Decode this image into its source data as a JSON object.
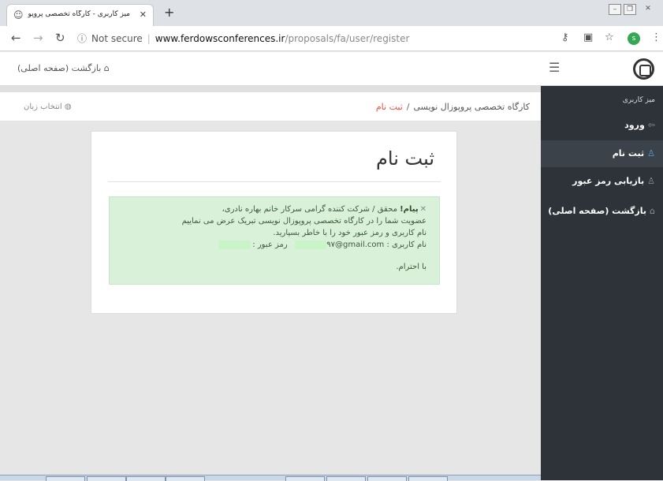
{
  "browser": {
    "tab_title": "میز کاربری - کارگاه تخصصی پروپوزال نو",
    "address": {
      "security_label": "Not secure",
      "host": "www.ferdowsconferences.ir",
      "path": "/proposals/fa/user/register"
    },
    "profile_letter": "s"
  },
  "header": {
    "back_label": "بازگشت (صفحه اصلی)"
  },
  "breadcrumb": {
    "parent": "کارگاه تخصصی پروپوزال نویسی",
    "separator": "/",
    "current": "ثبت نام"
  },
  "language_label": "انتخاب زبان",
  "sidebar": {
    "title": "میز کاربری",
    "items": [
      {
        "label": "ورود",
        "icon": "sign-in-icon"
      },
      {
        "label": "ثبت نام",
        "icon": "user-icon"
      },
      {
        "label": "بازیابی رمز عبور",
        "icon": "user-icon"
      },
      {
        "label": "بازگشت (صفحه اصلی)",
        "icon": "home-icon"
      }
    ]
  },
  "card": {
    "title": "ثبت نام",
    "alert": {
      "prefix": "پیام!",
      "line1": "محقق / شرکت کننده گرامی سرکار خانم بهاره نادری،",
      "line2": "عضویت شما را در کارگاه تخصصی پروپوزال نویسی تبریک عرض می نماییم",
      "line3": "نام کاربری و رمز عبور خود را با خاطر بسپارید.",
      "username_label": "نام کاربری :",
      "username_value": "۹۷@gmail.com",
      "password_label": "رمز عبور :",
      "signoff": "با احترام."
    }
  },
  "colors": {
    "sidebar_bg": "#2d3339",
    "alert_bg": "#d9f0d9",
    "breadcrumb_active": "#e74c3c",
    "active_icon": "#4aa3df"
  }
}
